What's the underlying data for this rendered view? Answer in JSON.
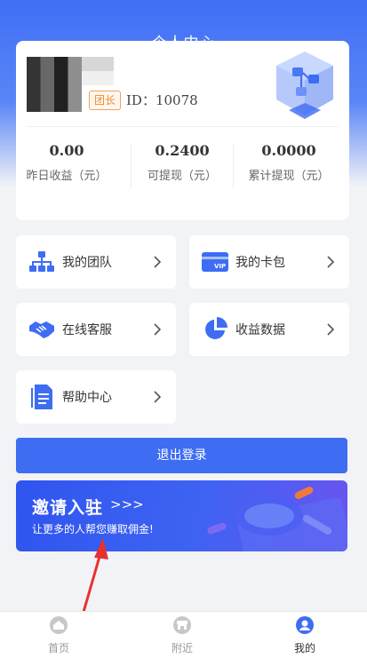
{
  "header": {
    "title": "个人中心"
  },
  "profile": {
    "role_badge": "团长",
    "id_text": "ID：10078"
  },
  "stats": [
    {
      "value": "0.00",
      "label": "昨日收益（元）"
    },
    {
      "value": "0.2400",
      "label": "可提现（元）"
    },
    {
      "value": "0.0000",
      "label": "累计提现（元）"
    }
  ],
  "menu": [
    {
      "label": "我的团队",
      "icon": "team-icon"
    },
    {
      "label": "我的卡包",
      "icon": "vip-card-icon"
    },
    {
      "label": "在线客服",
      "icon": "handshake-icon"
    },
    {
      "label": "收益数据",
      "icon": "pie-chart-icon"
    },
    {
      "label": "帮助中心",
      "icon": "document-icon"
    }
  ],
  "logout_label": "退出登录",
  "banner": {
    "title": "邀请入驻",
    "arrows": ">>>",
    "subtitle": "让更多的人帮您赚取佣金!"
  },
  "tabbar": [
    {
      "label": "首页",
      "icon": "home-icon",
      "active": false
    },
    {
      "label": "附近",
      "icon": "store-icon",
      "active": false
    },
    {
      "label": "我的",
      "icon": "user-icon",
      "active": true
    }
  ],
  "colors": {
    "primary": "#3e6df3",
    "badge": "#f08c2a",
    "annotation": "#e8312f"
  }
}
